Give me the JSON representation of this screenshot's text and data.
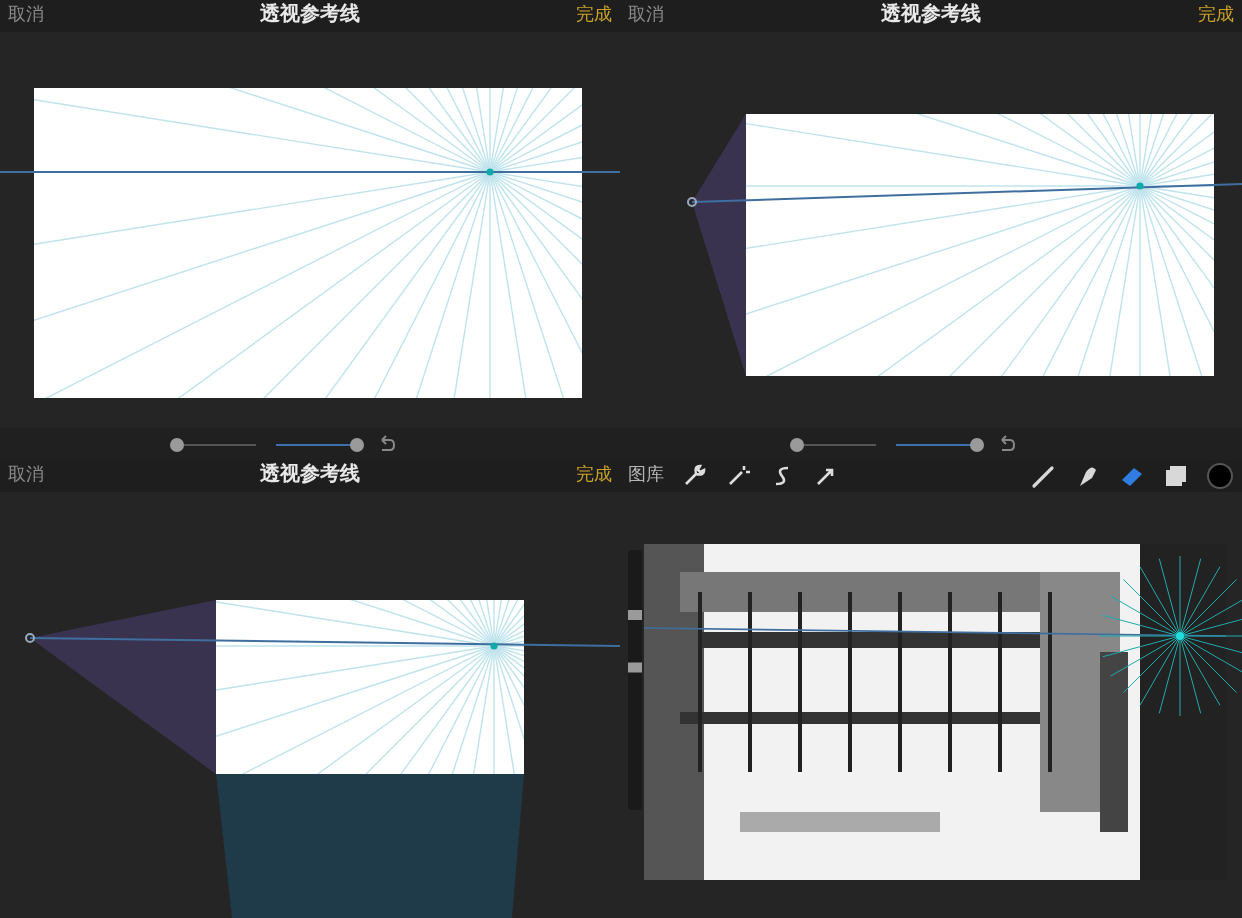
{
  "panels": [
    {
      "kind": "full",
      "cancel": "取消",
      "title": "透视参考线",
      "done": "完成",
      "sliders": [
        {
          "level": 0
        },
        {
          "level": 1
        }
      ]
    },
    {
      "kind": "right",
      "cancel": "取消",
      "title": "透视参考线",
      "done": "完成",
      "sliders": [
        {
          "level": 0
        },
        {
          "level": 1
        }
      ]
    },
    {
      "kind": "crop",
      "cancel": "取消",
      "title": "透视参考线",
      "done": "完成"
    },
    {
      "kind": "paint",
      "gallery": "图库",
      "side_sliders": [
        {
          "level": 0.76
        },
        {
          "level": 0.55
        }
      ],
      "tools": [
        {
          "kind": "brush",
          "selected": false
        },
        {
          "kind": "smudge",
          "selected": false
        },
        {
          "kind": "eraser",
          "selected": true
        },
        {
          "kind": "layers",
          "selected": false
        },
        {
          "kind": "color",
          "selected": false
        }
      ]
    }
  ]
}
